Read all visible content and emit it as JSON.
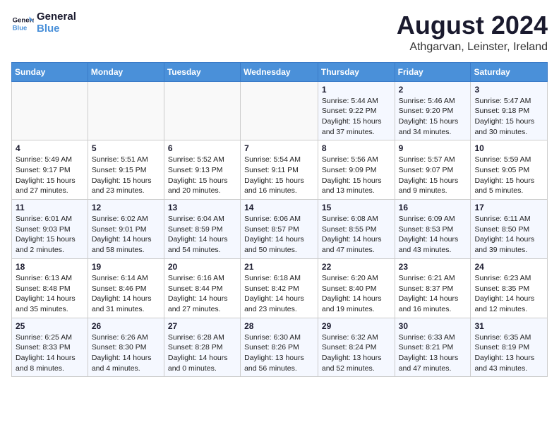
{
  "header": {
    "logo_line1": "General",
    "logo_line2": "Blue",
    "month_year": "August 2024",
    "location": "Athgarvan, Leinster, Ireland"
  },
  "weekdays": [
    "Sunday",
    "Monday",
    "Tuesday",
    "Wednesday",
    "Thursday",
    "Friday",
    "Saturday"
  ],
  "weeks": [
    [
      {
        "day": "",
        "sunrise": "",
        "sunset": "",
        "daylight": ""
      },
      {
        "day": "",
        "sunrise": "",
        "sunset": "",
        "daylight": ""
      },
      {
        "day": "",
        "sunrise": "",
        "sunset": "",
        "daylight": ""
      },
      {
        "day": "",
        "sunrise": "",
        "sunset": "",
        "daylight": ""
      },
      {
        "day": "1",
        "sunrise": "Sunrise: 5:44 AM",
        "sunset": "Sunset: 9:22 PM",
        "daylight": "Daylight: 15 hours and 37 minutes."
      },
      {
        "day": "2",
        "sunrise": "Sunrise: 5:46 AM",
        "sunset": "Sunset: 9:20 PM",
        "daylight": "Daylight: 15 hours and 34 minutes."
      },
      {
        "day": "3",
        "sunrise": "Sunrise: 5:47 AM",
        "sunset": "Sunset: 9:18 PM",
        "daylight": "Daylight: 15 hours and 30 minutes."
      }
    ],
    [
      {
        "day": "4",
        "sunrise": "Sunrise: 5:49 AM",
        "sunset": "Sunset: 9:17 PM",
        "daylight": "Daylight: 15 hours and 27 minutes."
      },
      {
        "day": "5",
        "sunrise": "Sunrise: 5:51 AM",
        "sunset": "Sunset: 9:15 PM",
        "daylight": "Daylight: 15 hours and 23 minutes."
      },
      {
        "day": "6",
        "sunrise": "Sunrise: 5:52 AM",
        "sunset": "Sunset: 9:13 PM",
        "daylight": "Daylight: 15 hours and 20 minutes."
      },
      {
        "day": "7",
        "sunrise": "Sunrise: 5:54 AM",
        "sunset": "Sunset: 9:11 PM",
        "daylight": "Daylight: 15 hours and 16 minutes."
      },
      {
        "day": "8",
        "sunrise": "Sunrise: 5:56 AM",
        "sunset": "Sunset: 9:09 PM",
        "daylight": "Daylight: 15 hours and 13 minutes."
      },
      {
        "day": "9",
        "sunrise": "Sunrise: 5:57 AM",
        "sunset": "Sunset: 9:07 PM",
        "daylight": "Daylight: 15 hours and 9 minutes."
      },
      {
        "day": "10",
        "sunrise": "Sunrise: 5:59 AM",
        "sunset": "Sunset: 9:05 PM",
        "daylight": "Daylight: 15 hours and 5 minutes."
      }
    ],
    [
      {
        "day": "11",
        "sunrise": "Sunrise: 6:01 AM",
        "sunset": "Sunset: 9:03 PM",
        "daylight": "Daylight: 15 hours and 2 minutes."
      },
      {
        "day": "12",
        "sunrise": "Sunrise: 6:02 AM",
        "sunset": "Sunset: 9:01 PM",
        "daylight": "Daylight: 14 hours and 58 minutes."
      },
      {
        "day": "13",
        "sunrise": "Sunrise: 6:04 AM",
        "sunset": "Sunset: 8:59 PM",
        "daylight": "Daylight: 14 hours and 54 minutes."
      },
      {
        "day": "14",
        "sunrise": "Sunrise: 6:06 AM",
        "sunset": "Sunset: 8:57 PM",
        "daylight": "Daylight: 14 hours and 50 minutes."
      },
      {
        "day": "15",
        "sunrise": "Sunrise: 6:08 AM",
        "sunset": "Sunset: 8:55 PM",
        "daylight": "Daylight: 14 hours and 47 minutes."
      },
      {
        "day": "16",
        "sunrise": "Sunrise: 6:09 AM",
        "sunset": "Sunset: 8:53 PM",
        "daylight": "Daylight: 14 hours and 43 minutes."
      },
      {
        "day": "17",
        "sunrise": "Sunrise: 6:11 AM",
        "sunset": "Sunset: 8:50 PM",
        "daylight": "Daylight: 14 hours and 39 minutes."
      }
    ],
    [
      {
        "day": "18",
        "sunrise": "Sunrise: 6:13 AM",
        "sunset": "Sunset: 8:48 PM",
        "daylight": "Daylight: 14 hours and 35 minutes."
      },
      {
        "day": "19",
        "sunrise": "Sunrise: 6:14 AM",
        "sunset": "Sunset: 8:46 PM",
        "daylight": "Daylight: 14 hours and 31 minutes."
      },
      {
        "day": "20",
        "sunrise": "Sunrise: 6:16 AM",
        "sunset": "Sunset: 8:44 PM",
        "daylight": "Daylight: 14 hours and 27 minutes."
      },
      {
        "day": "21",
        "sunrise": "Sunrise: 6:18 AM",
        "sunset": "Sunset: 8:42 PM",
        "daylight": "Daylight: 14 hours and 23 minutes."
      },
      {
        "day": "22",
        "sunrise": "Sunrise: 6:20 AM",
        "sunset": "Sunset: 8:40 PM",
        "daylight": "Daylight: 14 hours and 19 minutes."
      },
      {
        "day": "23",
        "sunrise": "Sunrise: 6:21 AM",
        "sunset": "Sunset: 8:37 PM",
        "daylight": "Daylight: 14 hours and 16 minutes."
      },
      {
        "day": "24",
        "sunrise": "Sunrise: 6:23 AM",
        "sunset": "Sunset: 8:35 PM",
        "daylight": "Daylight: 14 hours and 12 minutes."
      }
    ],
    [
      {
        "day": "25",
        "sunrise": "Sunrise: 6:25 AM",
        "sunset": "Sunset: 8:33 PM",
        "daylight": "Daylight: 14 hours and 8 minutes."
      },
      {
        "day": "26",
        "sunrise": "Sunrise: 6:26 AM",
        "sunset": "Sunset: 8:30 PM",
        "daylight": "Daylight: 14 hours and 4 minutes."
      },
      {
        "day": "27",
        "sunrise": "Sunrise: 6:28 AM",
        "sunset": "Sunset: 8:28 PM",
        "daylight": "Daylight: 14 hours and 0 minutes."
      },
      {
        "day": "28",
        "sunrise": "Sunrise: 6:30 AM",
        "sunset": "Sunset: 8:26 PM",
        "daylight": "Daylight: 13 hours and 56 minutes."
      },
      {
        "day": "29",
        "sunrise": "Sunrise: 6:32 AM",
        "sunset": "Sunset: 8:24 PM",
        "daylight": "Daylight: 13 hours and 52 minutes."
      },
      {
        "day": "30",
        "sunrise": "Sunrise: 6:33 AM",
        "sunset": "Sunset: 8:21 PM",
        "daylight": "Daylight: 13 hours and 47 minutes."
      },
      {
        "day": "31",
        "sunrise": "Sunrise: 6:35 AM",
        "sunset": "Sunset: 8:19 PM",
        "daylight": "Daylight: 13 hours and 43 minutes."
      }
    ]
  ]
}
